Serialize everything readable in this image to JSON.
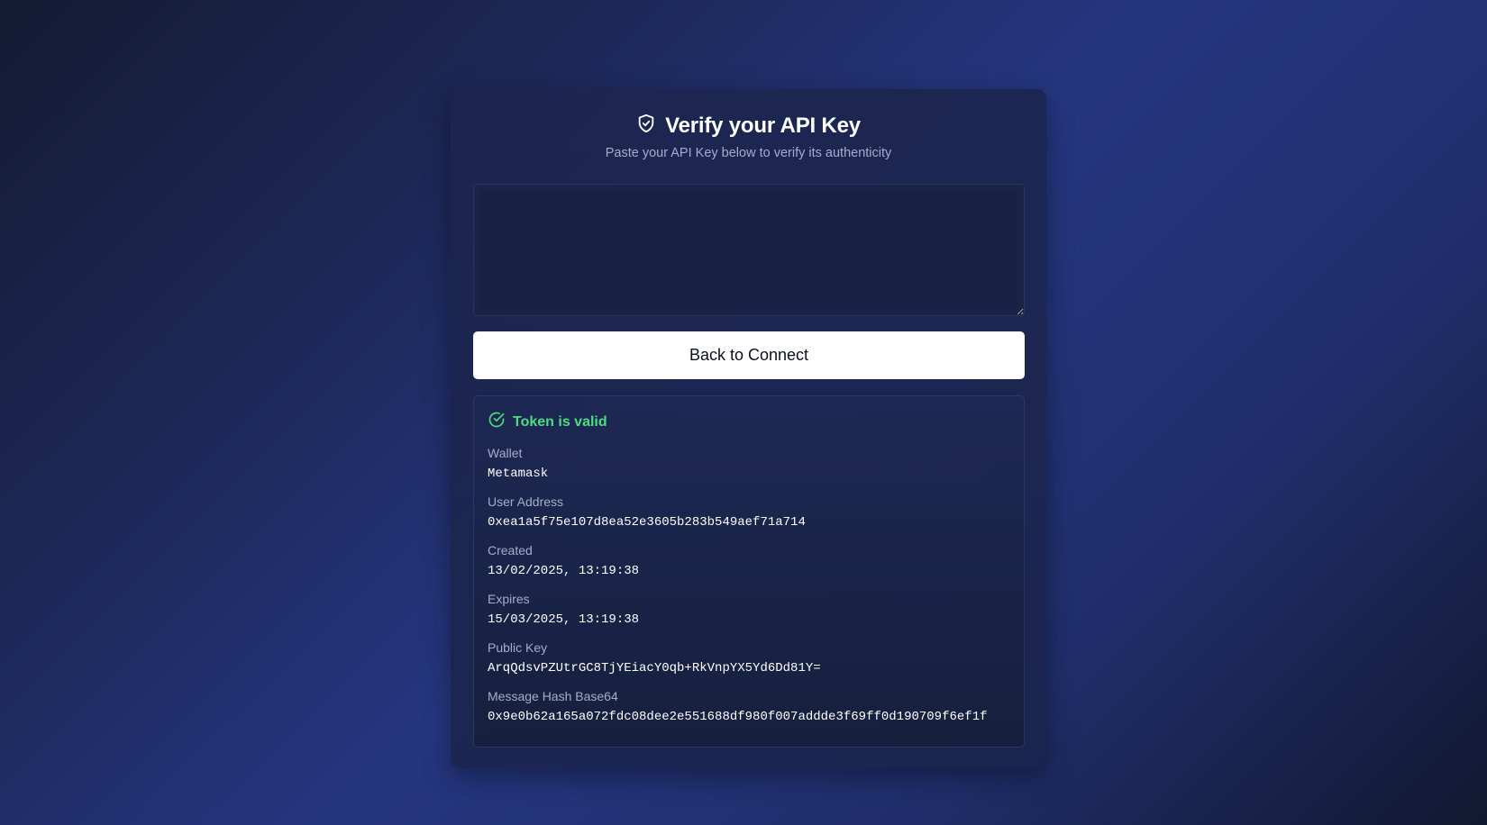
{
  "header": {
    "title": "Verify your API Key",
    "subtitle": "Paste your API Key below to verify its authenticity",
    "icon": "shield-check-icon"
  },
  "api_key_input": {
    "value": "",
    "placeholder": ""
  },
  "actions": {
    "back_label": "Back to Connect"
  },
  "result": {
    "status_icon": "check-circle-icon",
    "status_text": "Token is valid",
    "status_color": "#4ade80",
    "fields": [
      {
        "label": "Wallet",
        "value": "Metamask"
      },
      {
        "label": "User Address",
        "value": "0xea1a5f75e107d8ea52e3605b283b549aef71a714"
      },
      {
        "label": "Created",
        "value": "13/02/2025, 13:19:38"
      },
      {
        "label": "Expires",
        "value": "15/03/2025, 13:19:38"
      },
      {
        "label": "Public Key",
        "value": "ArqQdsvPZUtrGC8TjYEiacY0qb+RkVnpYX5Yd6Dd81Y="
      },
      {
        "label": "Message Hash Base64",
        "value": "0x9e0b62a165a072fdc08dee2e551688df980f007addde3f69ff0d190709f6ef1f"
      }
    ]
  }
}
